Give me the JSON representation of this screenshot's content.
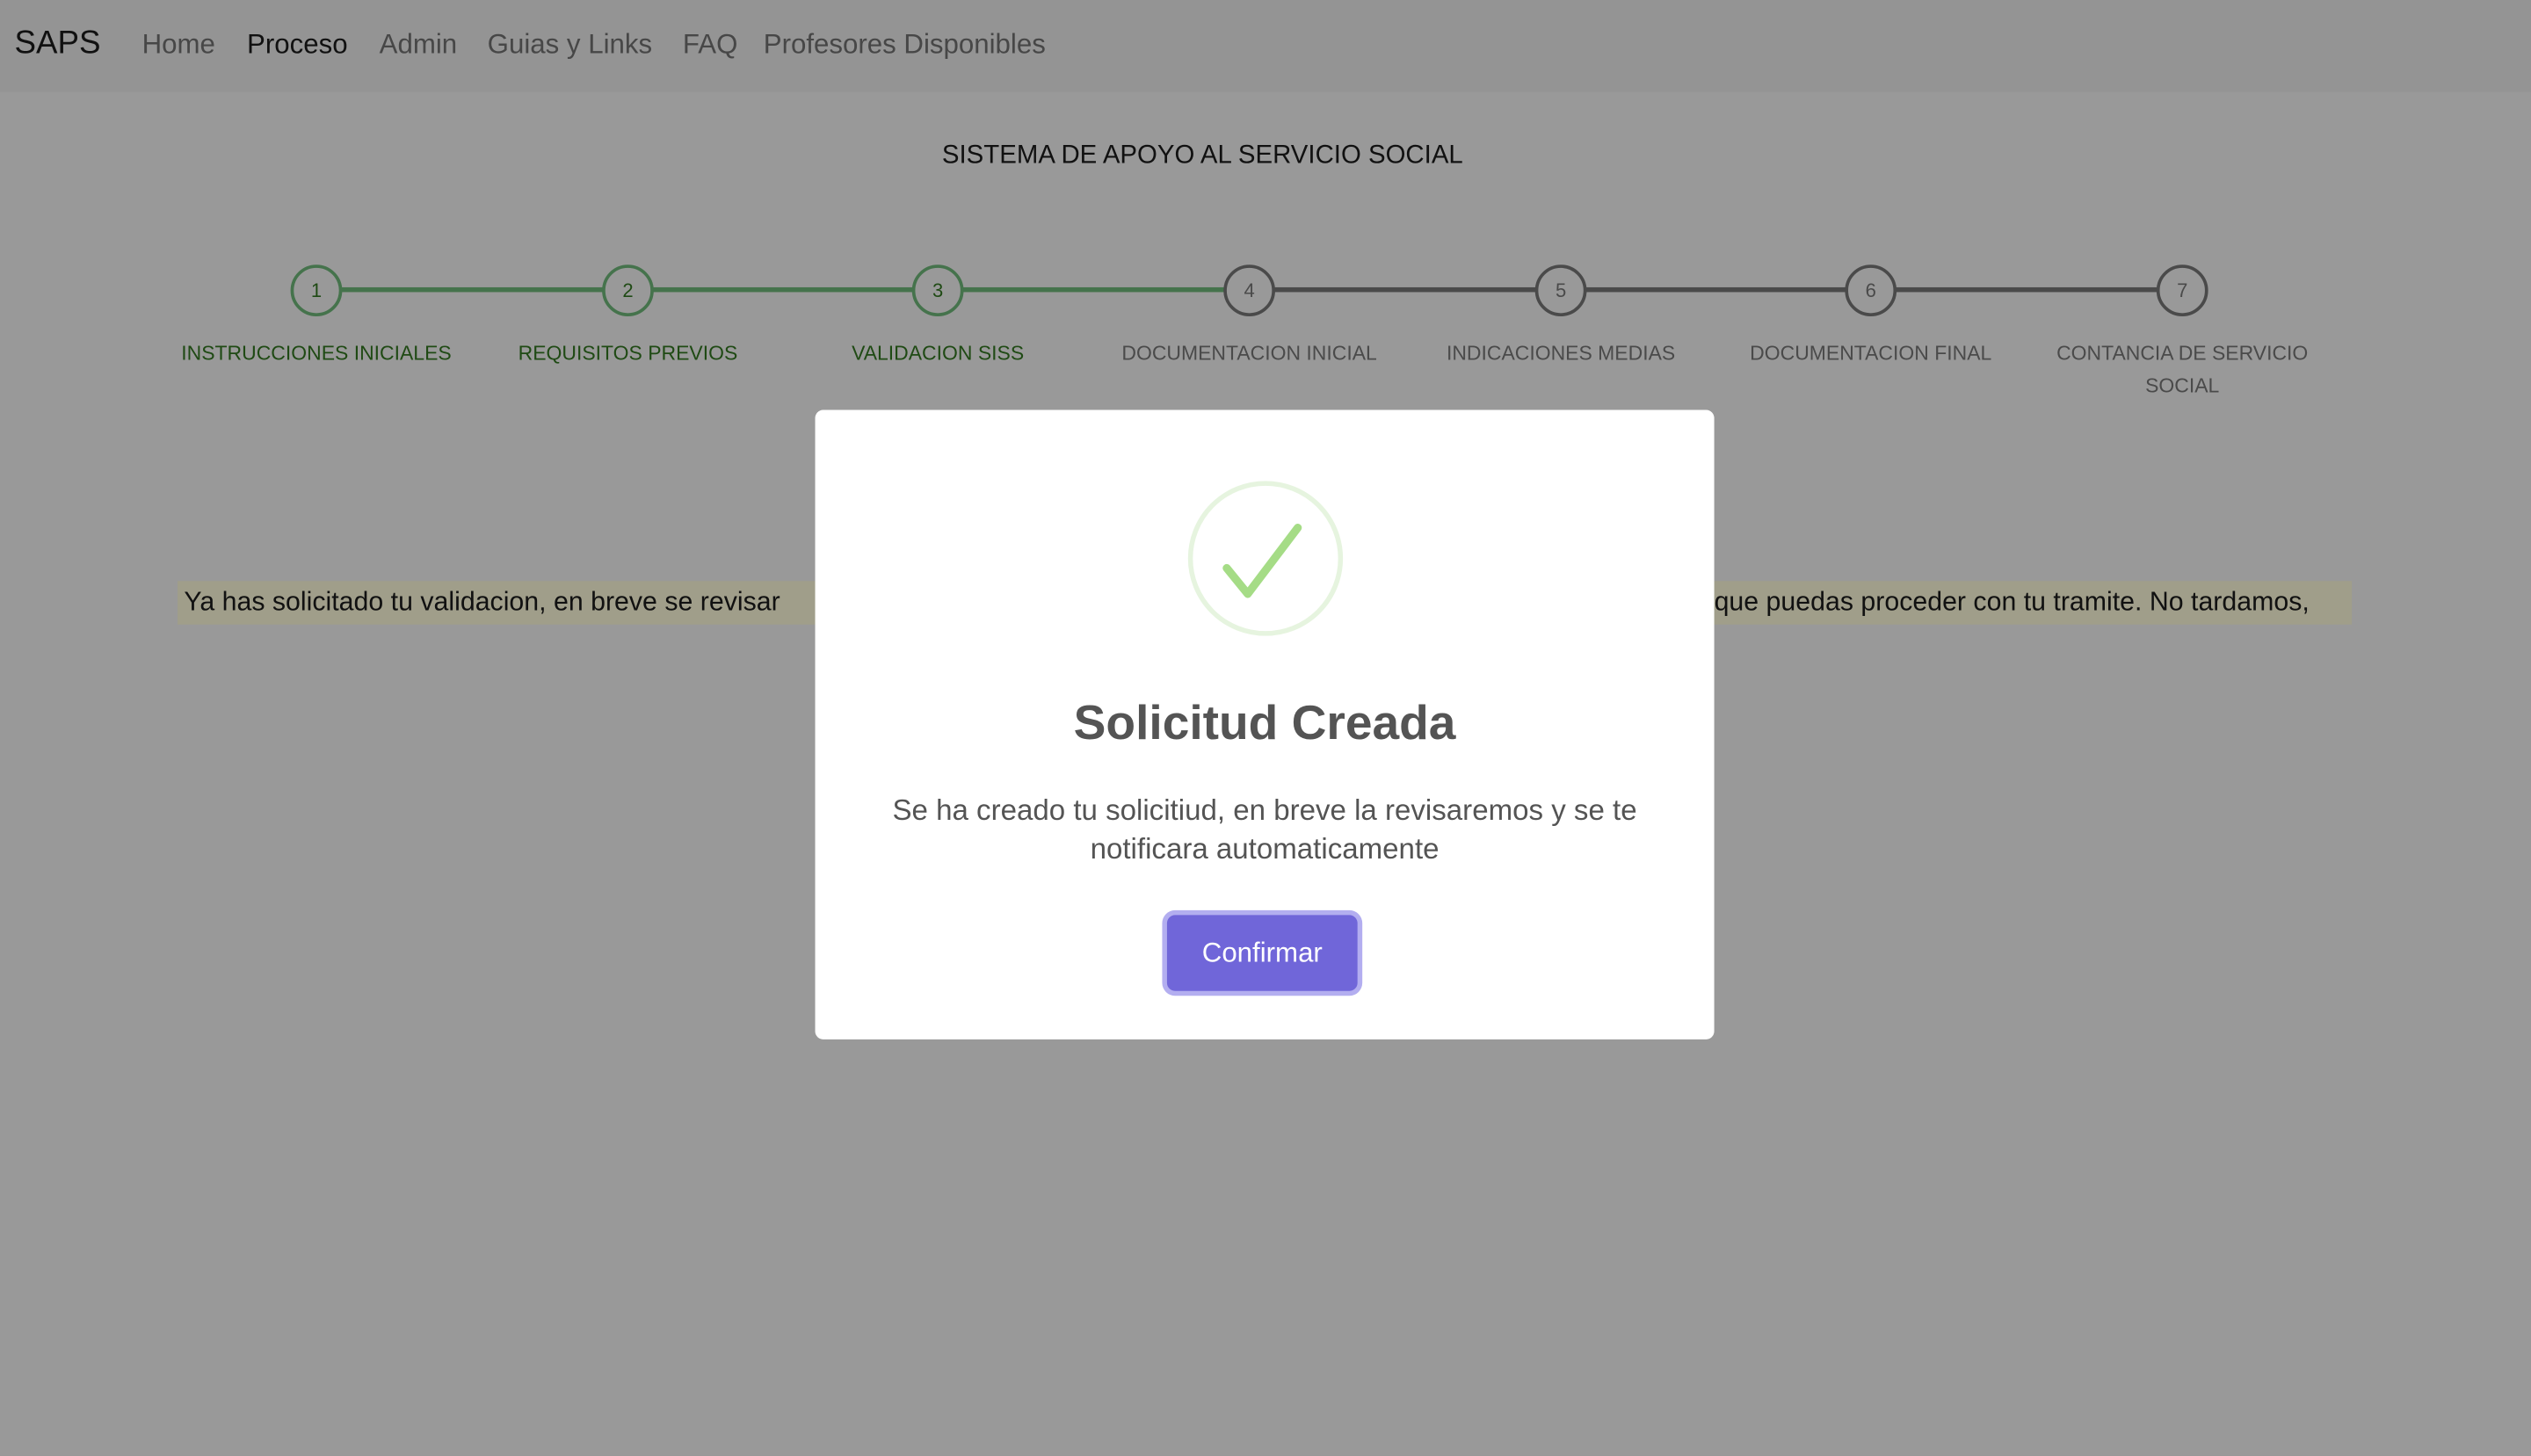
{
  "nav": {
    "brand": "SAPS",
    "links": [
      "Home",
      "Proceso",
      "Admin",
      "Guias y Links",
      "FAQ",
      "Profesores Disponibles"
    ],
    "active": "Proceso"
  },
  "page_title": "SISTEMA DE APOYO AL SERVICIO SOCIAL",
  "steps": [
    {
      "number": "1",
      "label": "INSTRUCCIONES INICIALES",
      "completed": true
    },
    {
      "number": "2",
      "label": "REQUISITOS PREVIOS",
      "completed": true
    },
    {
      "number": "3",
      "label": "VALIDACION SISS",
      "completed": true
    },
    {
      "number": "4",
      "label": "DOCUMENTACION INICIAL",
      "completed": false
    },
    {
      "number": "5",
      "label": "INDICACIONES MEDIAS",
      "completed": false
    },
    {
      "number": "6",
      "label": "DOCUMENTACION FINAL",
      "completed": false
    },
    {
      "number": "7",
      "label": "CONTANCIA DE SERVICIO SOCIAL",
      "completed": false
    }
  ],
  "notice": {
    "left_visible": "Ya has solicitado tu validacion, en breve se revisar",
    "right_visible": "que puedas proceder con tu tramite. No tardamos,"
  },
  "modal": {
    "icon": "success-check-icon",
    "title": "Solicitud Creada",
    "message": "Se ha creado tu solicitiud, en breve la revisaremos y se te notificara automaticamente",
    "confirm_label": "Confirmar"
  },
  "colors": {
    "accent": "#7066d9",
    "step_done": "#45734c",
    "success": "#a5dc86"
  }
}
